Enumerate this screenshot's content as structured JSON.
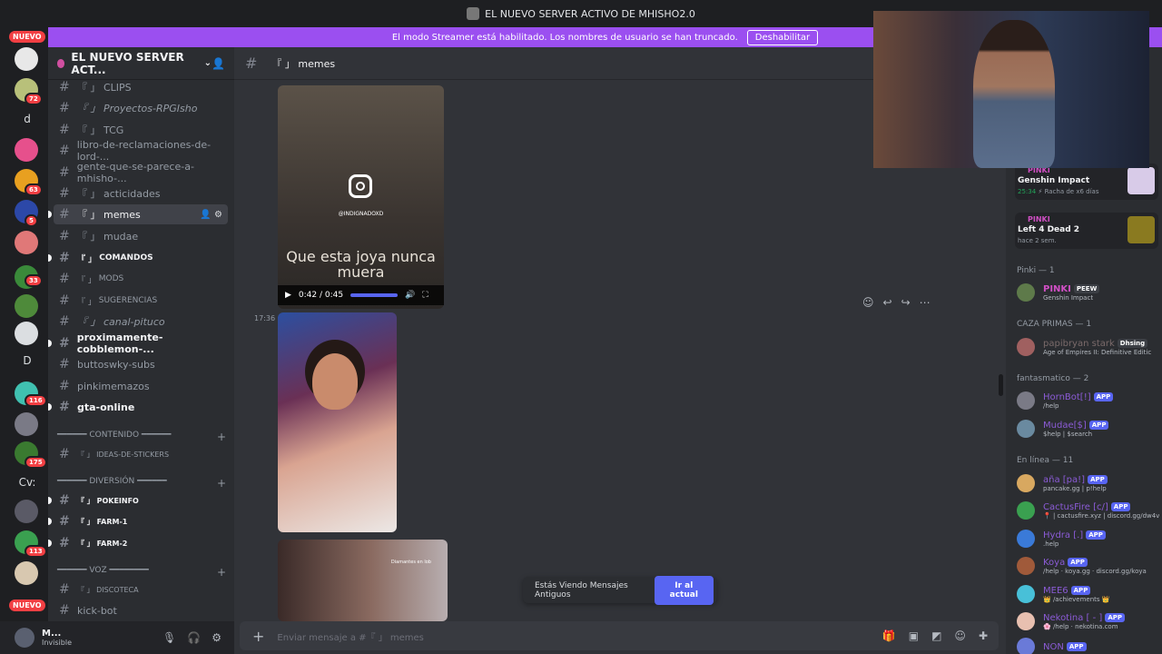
{
  "titlebar": {
    "title": "EL NUEVO SERVER ACTIVO DE MHISHO2.0"
  },
  "banner": {
    "text": "El modo Streamer está habilitado. Los nombres de usuario se han truncado.",
    "button": "Deshabilitar"
  },
  "guilds": {
    "nuevo_top": "NUEVO",
    "nuevo_bottom": "NUEVO",
    "badges": [
      "72",
      "63",
      "5",
      "33",
      "116",
      "175",
      "113"
    ],
    "text_items": [
      "d",
      "D",
      "Cv:"
    ]
  },
  "server": {
    "name": "EL NUEVO SERVER ACT...",
    "chevron": "⌄"
  },
  "channels": [
    {
      "prefix": "『 」",
      "name": "CLIPS"
    },
    {
      "prefix": "『 」",
      "name": "Proyectos-RPGIsho"
    },
    {
      "prefix": "『 」",
      "name": "TCG"
    },
    {
      "prefix": "",
      "name": "libro-de-reclamaciones-de-lord-..."
    },
    {
      "prefix": "",
      "name": "gente-que-se-parece-a-mhisho-..."
    },
    {
      "prefix": "『 」",
      "name": "acticidades"
    },
    {
      "prefix": "『 」",
      "name": "memes"
    },
    {
      "prefix": "『 」",
      "name": "mudae"
    },
    {
      "prefix": "『 」",
      "name": "COMANDOS"
    },
    {
      "prefix": "『 」",
      "name": "MODS"
    },
    {
      "prefix": "『 」",
      "name": "SUGERENCIAS"
    },
    {
      "prefix": "『 」",
      "name": "canal-pituco"
    },
    {
      "prefix": "",
      "name": "proximamente-cobblemon-..."
    },
    {
      "prefix": "",
      "name": "buttoswky-subs"
    },
    {
      "prefix": "",
      "name": "pinkimemazos"
    },
    {
      "prefix": "",
      "name": "gta-online"
    }
  ],
  "categories": {
    "contenido": "━━━━━━ CONTENIDO ━━━━━━",
    "diversion": "━━━━━━ DIVERSIÓN ━━━━━━",
    "voz": "━━━━━━ VOZ ━━━━━━━━"
  },
  "channels_contenido": [
    {
      "prefix": "『 」",
      "name": "IDEAS-DE-STICKERS"
    }
  ],
  "channels_diversion": [
    {
      "prefix": "『 」",
      "name": "POKEINFO"
    },
    {
      "prefix": "『 」",
      "name": "FARM-1"
    },
    {
      "prefix": "『 」",
      "name": "FARM-2"
    }
  ],
  "channels_voz": [
    {
      "prefix": "『 」",
      "name": "DISCOTECA"
    },
    {
      "prefix": "",
      "name": "kick-bot"
    }
  ],
  "user": {
    "name": "M...",
    "status": "Invisible"
  },
  "chat": {
    "channel": "『 」 memes",
    "video1": {
      "handle": "@INDIGNADOXD",
      "caption": "Que esta joya nunca muera",
      "time": "0:42 / 0:45"
    },
    "timestamp": "17:36",
    "video3_watermark": "Diamantes en lob",
    "jump_text": "Estás Viendo Mensajes Antiguos",
    "jump_button": "Ir al actual",
    "input_placeholder": "Enviar mensaje a #『 」 memes"
  },
  "activities": [
    {
      "name": "PINKI",
      "game": "Genshin Impact",
      "time": "25:34",
      "detail": "Racha de x6 días"
    },
    {
      "name": "PINKI",
      "game": "Left 4 Dead 2",
      "detail": "hace 2 sem."
    }
  ],
  "sections": {
    "pinki": "Pinki — 1",
    "caza": "CAZA PRIMAS — 1",
    "fantasmatico": "fantasmatico — 2",
    "online": "En línea — 11"
  },
  "members": [
    {
      "name": "PINKI",
      "tag": "PEEW",
      "status": "Genshin Impact",
      "color": "#d04fc4"
    },
    {
      "name": "papibryan stark",
      "tag": "Dhsing",
      "status": "Age of Empires II: Definitive Editic",
      "color": "#7a6a6a"
    },
    {
      "name": "HornBot[!]",
      "tag": "APP",
      "status": "/help",
      "color": "#8b5bd6"
    },
    {
      "name": "Mudae[$]",
      "tag": "APP",
      "status": "$help | $search",
      "color": "#8b5bd6"
    },
    {
      "name": "aña [pa!]",
      "tag": "APP",
      "status": "pancake.gg | p!help",
      "color": "#8b5bd6"
    },
    {
      "name": "CactusFire [c/]",
      "tag": "APP",
      "status": "📍 | cactusfire.xyz | discord.gg/dw4v",
      "color": "#8b5bd6"
    },
    {
      "name": "Hydra [.]",
      "tag": "APP",
      "status": ".help",
      "color": "#8b5bd6"
    },
    {
      "name": "Koya",
      "tag": "APP",
      "status": "/help · koya.gg · discord.gg/koya",
      "color": "#8b5bd6"
    },
    {
      "name": "MEE6",
      "tag": "APP",
      "status": "👑 /achievements 👑",
      "color": "#8b5bd6"
    },
    {
      "name": "Nekotina [ - ]",
      "tag": "APP",
      "status": "🌸 /help · nekotina.com",
      "color": "#8b5bd6"
    },
    {
      "name": "NON",
      "tag": "APP",
      "status": "",
      "color": "#8b5bd6"
    }
  ],
  "colors": {
    "accent": "#5865f2",
    "banner": "#9b4ff0",
    "danger": "#f23f43",
    "online": "#23a559"
  }
}
